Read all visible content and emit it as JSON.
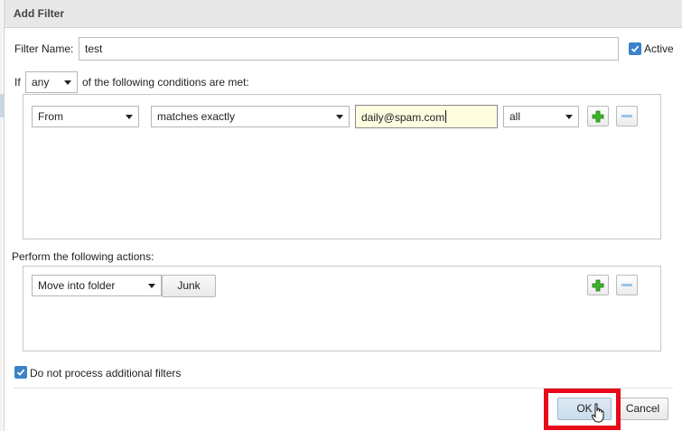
{
  "dialog": {
    "title": "Add Filter"
  },
  "filter_name": {
    "label": "Filter Name:",
    "value": "test"
  },
  "active": {
    "label": "Active",
    "checked": true
  },
  "condition_line": {
    "prefix": "If",
    "match_mode": "any",
    "suffix": "of the following conditions are met:"
  },
  "rule": {
    "field": "From",
    "operator": "matches exactly",
    "value": "daily@spam.com",
    "scope": "all"
  },
  "actions": {
    "heading": "Perform the following actions:",
    "action": "Move into folder",
    "folder": "Junk"
  },
  "stop_processing": {
    "label": "Do not process additional filters",
    "checked": true
  },
  "footer": {
    "ok": "OK",
    "cancel": "Cancel"
  },
  "colors": {
    "highlight_box": "#e8081a",
    "checkbox": "#3b82c8",
    "add_icon": "#2ea01d",
    "remove_icon": "#9cc2e6"
  }
}
